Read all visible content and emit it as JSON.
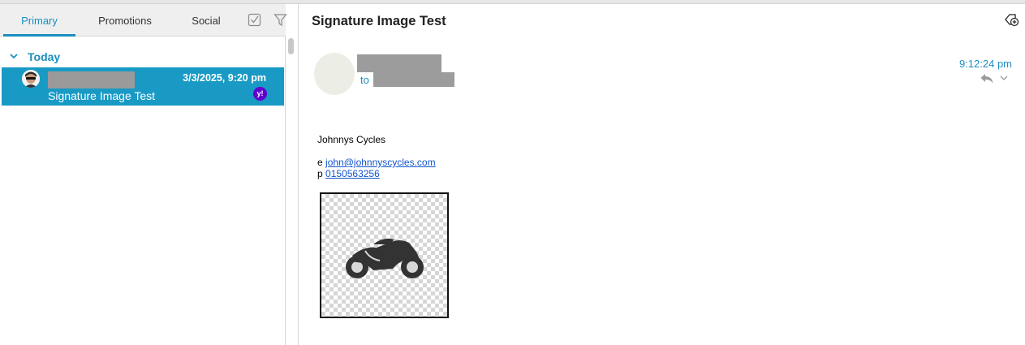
{
  "tabs": {
    "primary": "Primary",
    "promotions": "Promotions",
    "social": "Social"
  },
  "message_list": {
    "group_label": "Today",
    "selected_message": {
      "date": "3/3/2025, 9:20 pm",
      "subject": "Signature Image Test",
      "account_badge": "y!"
    }
  },
  "reader": {
    "subject": "Signature Image Test",
    "to_label": "to",
    "time": "9:12:24 pm",
    "body": {
      "company": "Johnnys Cycles",
      "email_prefix": "e",
      "email": "john@johnnyscycles.com",
      "phone_prefix": "p",
      "phone": "0150563256"
    }
  },
  "colors": {
    "accent": "#1a8fbf",
    "selection": "#189ac5",
    "link": "#1155cc"
  }
}
